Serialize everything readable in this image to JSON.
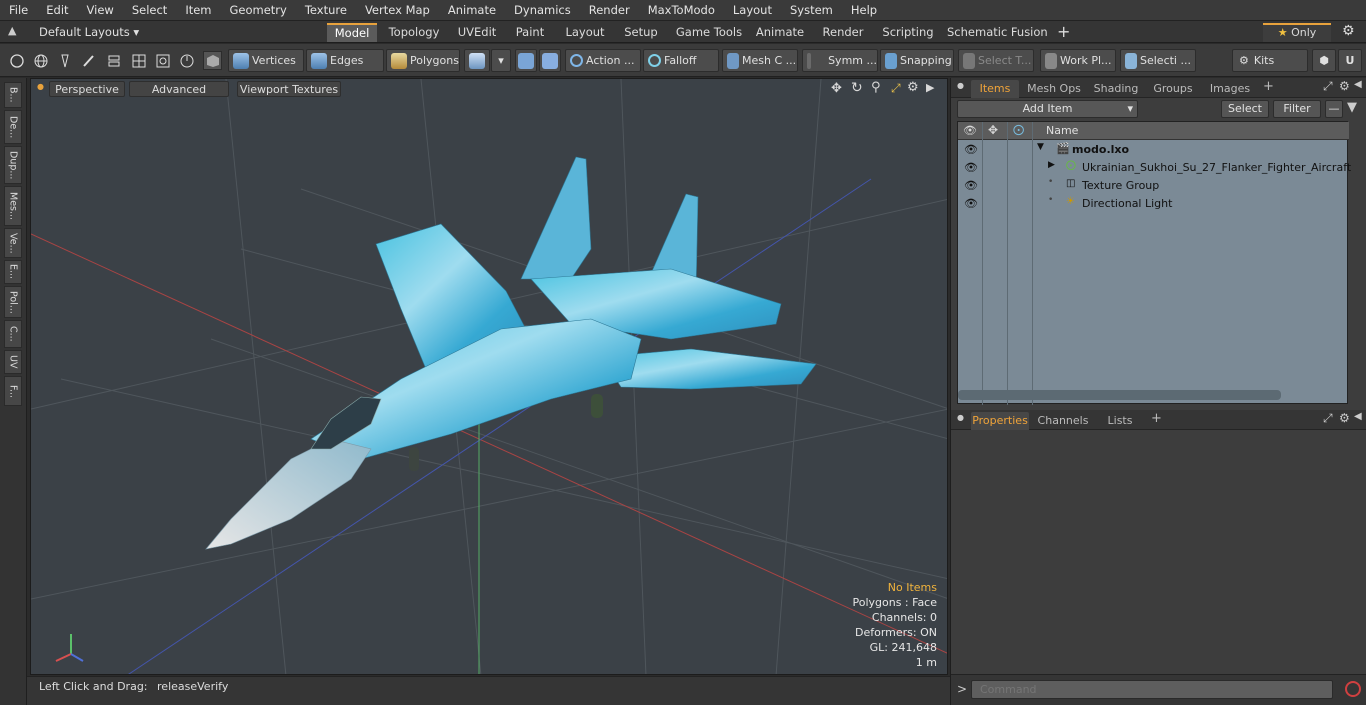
{
  "menu": [
    "File",
    "Edit",
    "View",
    "Select",
    "Item",
    "Geometry",
    "Texture",
    "Vertex Map",
    "Animate",
    "Dynamics",
    "Render",
    "MaxToModo",
    "Layout",
    "System",
    "Help"
  ],
  "layouts": {
    "label": "Default Layouts"
  },
  "layout_tabs": [
    "Model",
    "Topology",
    "UVEdit",
    "Paint",
    "Layout",
    "Setup",
    "Game Tools",
    "Animate",
    "Render",
    "Scripting",
    "Schematic Fusion"
  ],
  "only_label": "Only",
  "toolbar": {
    "vertices": "Vertices",
    "edges": "Edges",
    "polygons": "Polygons",
    "action": "Action ...",
    "falloff": "Falloff",
    "mesh": "Mesh C ...",
    "symm": "Symm ...",
    "snapping": "Snapping",
    "select_t": "Select T...",
    "work_pl": "Work Pl...",
    "selecti": "Selecti ...",
    "kits": "Kits"
  },
  "left_tabs": [
    "B...",
    "De...",
    "Dup...",
    "Mes...",
    "Ve...",
    "E...",
    "Pol...",
    "C...",
    "UV",
    "F..."
  ],
  "viewport": {
    "perspective": "Perspective",
    "advanced": "Advanced",
    "textures": "Viewport Textures"
  },
  "stats": {
    "items": "No Items",
    "polygons": "Polygons : Face",
    "channels": "Channels: 0",
    "deformers": "Deformers: ON",
    "gl": "GL: 241,648",
    "scale": "1 m"
  },
  "status": {
    "hint": "Left Click and Drag:",
    "action": "releaseVerify"
  },
  "items_panel": {
    "tabs": [
      "Items",
      "Mesh Ops",
      "Shading",
      "Groups",
      "Images"
    ],
    "add_item": "Add Item",
    "select": "Select",
    "filter": "Filter",
    "name_col": "Name",
    "rows": [
      {
        "label": "modo.lxo"
      },
      {
        "label": "Ukrainian_Sukhoi_Su_27_Flanker_Fighter_Aircraft"
      },
      {
        "label": "Texture Group"
      },
      {
        "label": "Directional Light"
      }
    ]
  },
  "props_panel": {
    "tabs": [
      "Properties",
      "Channels",
      "Lists"
    ]
  },
  "command": {
    "placeholder": "Command",
    "prompt": ">"
  },
  "colors": {
    "accent": "#e8a23c",
    "list_bg": "#7b8a96",
    "viewport_bg": "#3b4147"
  }
}
